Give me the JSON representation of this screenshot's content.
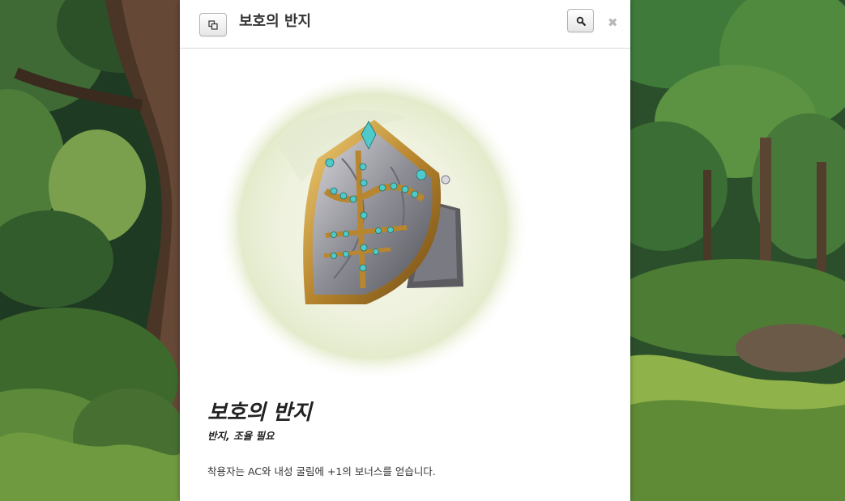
{
  "header": {
    "title": "보호의 반지",
    "copy_icon": "copy-icon",
    "search_icon": "search-icon",
    "close_icon": "close-icon",
    "close_glyph": "✖"
  },
  "item": {
    "name": "보호의 반지",
    "type_line": "반지, 조율 필요",
    "description": "착용자는 AC와 내성 굴림에 +1의 보너스를 얻습니다.",
    "image_subject": "ring-of-protection-illustration"
  },
  "background": {
    "subject": "forest-illustration"
  }
}
